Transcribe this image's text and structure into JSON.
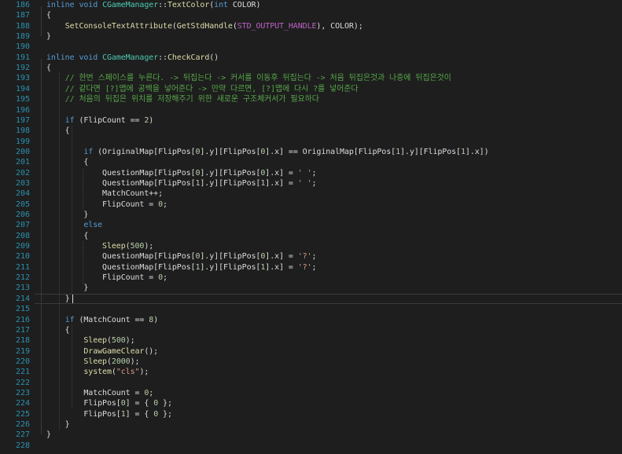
{
  "editor": {
    "lines": [
      {
        "n": "186",
        "segs": [
          [
            "kw",
            "inline "
          ],
          [
            "kw",
            "void "
          ],
          [
            "cls",
            "CGameManager"
          ],
          [
            "var",
            "::"
          ],
          [
            "fn",
            "TextColor"
          ],
          [
            "var",
            "("
          ],
          [
            "kw",
            "int "
          ],
          [
            "var",
            "COLOR)"
          ]
        ]
      },
      {
        "n": "187",
        "segs": [
          [
            "var",
            "{"
          ]
        ]
      },
      {
        "n": "188",
        "segs": [
          [
            "var",
            "    "
          ],
          [
            "fn",
            "SetConsoleTextAttribute"
          ],
          [
            "var",
            "("
          ],
          [
            "fn",
            "GetStdHandle"
          ],
          [
            "var",
            "("
          ],
          [
            "macro",
            "STD_OUTPUT_HANDLE"
          ],
          [
            "var",
            "), COLOR);"
          ]
        ]
      },
      {
        "n": "189",
        "segs": [
          [
            "var",
            "}"
          ]
        ]
      },
      {
        "n": "190",
        "segs": []
      },
      {
        "n": "191",
        "segs": [
          [
            "kw",
            "inline "
          ],
          [
            "kw",
            "void "
          ],
          [
            "cls",
            "CGameManager"
          ],
          [
            "var",
            "::"
          ],
          [
            "fn",
            "CheckCard"
          ],
          [
            "var",
            "()"
          ]
        ]
      },
      {
        "n": "192",
        "segs": [
          [
            "var",
            "{"
          ]
        ]
      },
      {
        "n": "193",
        "segs": [
          [
            "var",
            "    "
          ],
          [
            "cmt",
            "// 한번 스페이스를 누른다. -> 뒤집는다 -> 커서를 이동후 뒤집는다 -> 처음 뒤집은것과 나중에 뒤집은것이"
          ]
        ]
      },
      {
        "n": "194",
        "segs": [
          [
            "var",
            "    "
          ],
          [
            "cmt",
            "// 같다면 [?]맵에 공백을 넣어준다 -> 만약 다르면, [?]맵에 다시 ?를 넣어준다"
          ]
        ]
      },
      {
        "n": "195",
        "segs": [
          [
            "var",
            "    "
          ],
          [
            "cmt",
            "// 처음의 뒤집은 위치를 저장해주기 위한 새로운 구조체커서가 필요하다"
          ]
        ]
      },
      {
        "n": "196",
        "segs": []
      },
      {
        "n": "197",
        "segs": [
          [
            "var",
            "    "
          ],
          [
            "kw",
            "if "
          ],
          [
            "var",
            "(FlipCount == "
          ],
          [
            "num",
            "2"
          ],
          [
            "var",
            ")"
          ]
        ]
      },
      {
        "n": "198",
        "segs": [
          [
            "var",
            "    {"
          ]
        ]
      },
      {
        "n": "199",
        "segs": []
      },
      {
        "n": "200",
        "segs": [
          [
            "var",
            "        "
          ],
          [
            "kw",
            "if "
          ],
          [
            "var",
            "(OriginalMap[FlipPos["
          ],
          [
            "num",
            "0"
          ],
          [
            "var",
            "].y][FlipPos["
          ],
          [
            "num",
            "0"
          ],
          [
            "var",
            "].x] == OriginalMap[FlipPos["
          ],
          [
            "num",
            "1"
          ],
          [
            "var",
            "].y][FlipPos["
          ],
          [
            "num",
            "1"
          ],
          [
            "var",
            "].x])"
          ]
        ]
      },
      {
        "n": "201",
        "segs": [
          [
            "var",
            "        {"
          ]
        ]
      },
      {
        "n": "202",
        "segs": [
          [
            "var",
            "            QuestionMap[FlipPos["
          ],
          [
            "num",
            "0"
          ],
          [
            "var",
            "].y][FlipPos["
          ],
          [
            "num",
            "0"
          ],
          [
            "var",
            "].x] = "
          ],
          [
            "str",
            "' '"
          ],
          [
            "var",
            ";"
          ]
        ]
      },
      {
        "n": "203",
        "segs": [
          [
            "var",
            "            QuestionMap[FlipPos["
          ],
          [
            "num",
            "1"
          ],
          [
            "var",
            "].y][FlipPos["
          ],
          [
            "num",
            "1"
          ],
          [
            "var",
            "].x] = "
          ],
          [
            "str",
            "' '"
          ],
          [
            "var",
            ";"
          ]
        ]
      },
      {
        "n": "204",
        "segs": [
          [
            "var",
            "            MatchCount++;"
          ]
        ]
      },
      {
        "n": "205",
        "segs": [
          [
            "var",
            "            FlipCount = "
          ],
          [
            "num",
            "0"
          ],
          [
            "var",
            ";"
          ]
        ]
      },
      {
        "n": "206",
        "segs": [
          [
            "var",
            "        }"
          ]
        ]
      },
      {
        "n": "207",
        "segs": [
          [
            "var",
            "        "
          ],
          [
            "kw",
            "else"
          ]
        ]
      },
      {
        "n": "208",
        "segs": [
          [
            "var",
            "        {"
          ]
        ]
      },
      {
        "n": "209",
        "segs": [
          [
            "var",
            "            "
          ],
          [
            "fn",
            "Sleep"
          ],
          [
            "var",
            "("
          ],
          [
            "num",
            "500"
          ],
          [
            "var",
            ");"
          ]
        ]
      },
      {
        "n": "210",
        "segs": [
          [
            "var",
            "            QuestionMap[FlipPos["
          ],
          [
            "num",
            "0"
          ],
          [
            "var",
            "].y][FlipPos["
          ],
          [
            "num",
            "0"
          ],
          [
            "var",
            "].x] = "
          ],
          [
            "str",
            "'?'"
          ],
          [
            "var",
            ";"
          ]
        ]
      },
      {
        "n": "211",
        "segs": [
          [
            "var",
            "            QuestionMap[FlipPos["
          ],
          [
            "num",
            "1"
          ],
          [
            "var",
            "].y][FlipPos["
          ],
          [
            "num",
            "1"
          ],
          [
            "var",
            "].x] = "
          ],
          [
            "str",
            "'?'"
          ],
          [
            "var",
            ";"
          ]
        ]
      },
      {
        "n": "212",
        "segs": [
          [
            "var",
            "            FlipCount = "
          ],
          [
            "num",
            "0"
          ],
          [
            "var",
            ";"
          ]
        ]
      },
      {
        "n": "213",
        "segs": [
          [
            "var",
            "        }"
          ]
        ]
      },
      {
        "n": "214",
        "segs": [
          [
            "var",
            "    "
          ],
          [
            "var",
            "}"
          ]
        ]
      },
      {
        "n": "215",
        "segs": []
      },
      {
        "n": "216",
        "segs": [
          [
            "var",
            "    "
          ],
          [
            "kw",
            "if "
          ],
          [
            "var",
            "(MatchCount == "
          ],
          [
            "num",
            "8"
          ],
          [
            "var",
            ")"
          ]
        ]
      },
      {
        "n": "217",
        "segs": [
          [
            "var",
            "    {"
          ]
        ]
      },
      {
        "n": "218",
        "segs": [
          [
            "var",
            "        "
          ],
          [
            "fn",
            "Sleep"
          ],
          [
            "var",
            "("
          ],
          [
            "num",
            "500"
          ],
          [
            "var",
            ");"
          ]
        ]
      },
      {
        "n": "219",
        "segs": [
          [
            "var",
            "        "
          ],
          [
            "fn",
            "DrawGameClear"
          ],
          [
            "var",
            "();"
          ]
        ]
      },
      {
        "n": "220",
        "segs": [
          [
            "var",
            "        "
          ],
          [
            "fn",
            "Sleep"
          ],
          [
            "var",
            "("
          ],
          [
            "num",
            "2000"
          ],
          [
            "var",
            ");"
          ]
        ]
      },
      {
        "n": "221",
        "segs": [
          [
            "var",
            "        "
          ],
          [
            "fn",
            "system"
          ],
          [
            "var",
            "("
          ],
          [
            "str",
            "\"cls\""
          ],
          [
            "var",
            ");"
          ]
        ]
      },
      {
        "n": "222",
        "segs": []
      },
      {
        "n": "223",
        "segs": [
          [
            "var",
            "        MatchCount = "
          ],
          [
            "num",
            "0"
          ],
          [
            "var",
            ";"
          ]
        ]
      },
      {
        "n": "224",
        "segs": [
          [
            "var",
            "        FlipPos["
          ],
          [
            "num",
            "0"
          ],
          [
            "var",
            "] = { "
          ],
          [
            "num",
            "0"
          ],
          [
            "var",
            " };"
          ]
        ]
      },
      {
        "n": "225",
        "segs": [
          [
            "var",
            "        FlipPos["
          ],
          [
            "num",
            "1"
          ],
          [
            "var",
            "] = { "
          ],
          [
            "num",
            "0"
          ],
          [
            "var",
            " };"
          ]
        ]
      },
      {
        "n": "226",
        "segs": [
          [
            "var",
            "    }"
          ]
        ]
      },
      {
        "n": "227",
        "segs": [
          [
            "var",
            "}"
          ]
        ]
      },
      {
        "n": "228",
        "segs": []
      }
    ],
    "colors": {
      "background": "#1e1e1e",
      "line_number": "#2b91af",
      "keyword": "#569cd6",
      "class": "#4ec9b0",
      "function": "#dcdcaa",
      "comment": "#57a64a",
      "string": "#d69d85",
      "number": "#b5cea8",
      "text": "#dcdcdc"
    },
    "current_line": "214"
  }
}
